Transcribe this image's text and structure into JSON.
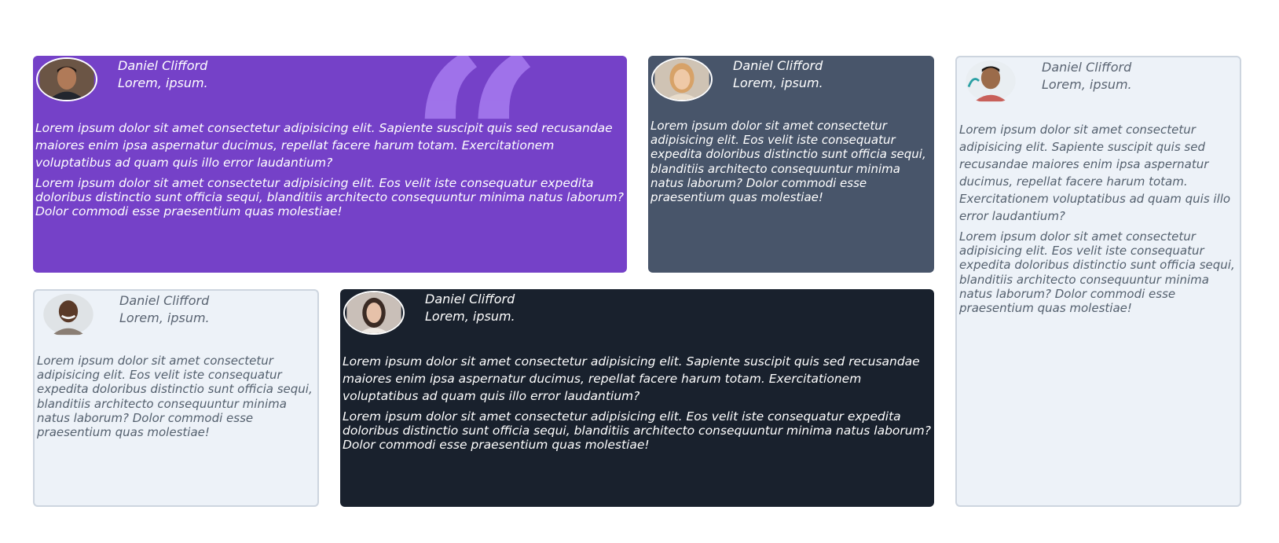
{
  "cards": [
    {
      "name": "Daniel Clifford",
      "role": "Lorem, ipsum.",
      "p1": "Lorem ipsum dolor sit amet consectetur adipisicing elit. Sapiente suscipit quis sed recusandae maiores enim ipsa aspernatur ducimus, repellat facere harum totam. Exercitationem voluptatibus ad quam quis illo error laudantium?",
      "p2": "Lorem ipsum dolor sit amet consectetur adipisicing elit. Eos velit iste consequatur expedita doloribus distinctio sunt officia sequi, blanditiis architecto consequuntur minima natus laborum? Dolor commodi esse praesentium quas molestiae!",
      "quote_glyph": "“"
    },
    {
      "name": "Daniel Clifford",
      "role": "Lorem, ipsum.",
      "p2": "Lorem ipsum dolor sit amet consectetur adipisicing elit. Eos velit iste consequatur expedita doloribus distinctio sunt officia sequi, blanditiis architecto consequuntur minima natus laborum? Dolor commodi esse praesentium quas molestiae!"
    },
    {
      "name": "Daniel Clifford",
      "role": "Lorem, ipsum.",
      "p1": "Lorem ipsum dolor sit amet consectetur adipisicing elit. Sapiente suscipit quis sed recusandae maiores enim ipsa aspernatur ducimus, repellat facere harum totam. Exercitationem voluptatibus ad quam quis illo error laudantium?",
      "p2": "Lorem ipsum dolor sit amet consectetur adipisicing elit. Eos velit iste consequatur expedita doloribus distinctio sunt officia sequi, blanditiis architecto consequuntur minima natus laborum? Dolor commodi esse praesentium quas molestiae!"
    },
    {
      "name": "Daniel Clifford",
      "role": "Lorem, ipsum.",
      "p2": "Lorem ipsum dolor sit amet consectetur adipisicing elit. Eos velit iste consequatur expedita doloribus distinctio sunt officia sequi, blanditiis architecto consequuntur minima natus laborum? Dolor commodi esse praesentium quas molestiae!"
    },
    {
      "name": "Daniel Clifford",
      "role": "Lorem, ipsum.",
      "p1": "Lorem ipsum dolor sit amet consectetur adipisicing elit. Sapiente suscipit quis sed recusandae maiores enim ipsa aspernatur ducimus, repellat facere harum totam. Exercitationem voluptatibus ad quam quis illo error laudantium?",
      "p2": "Lorem ipsum dolor sit amet consectetur adipisicing elit. Eos velit iste consequatur expedita doloribus distinctio sunt officia sequi, blanditiis architecto consequuntur minima natus laborum? Dolor commodi esse praesentium quas molestiae!"
    }
  ],
  "colors": {
    "purple": "#7541c8",
    "slate": "#48556a",
    "dark": "#19212d",
    "light": "#edf2f8",
    "quote": "#a77cf0"
  }
}
